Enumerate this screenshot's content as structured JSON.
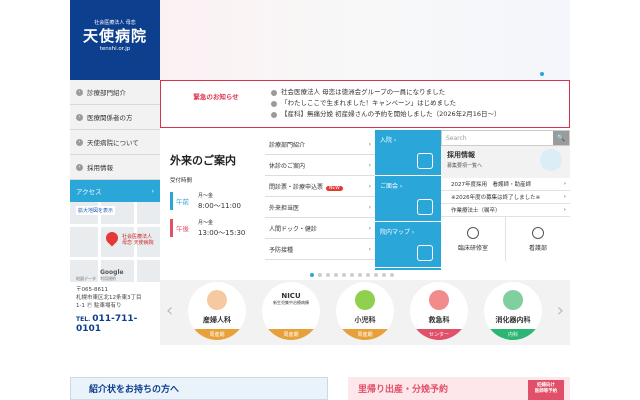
{
  "logo": {
    "org": "社会医療法人 母恋",
    "name": "天使病院",
    "url": "tenshi.or.jp"
  },
  "sidebar": {
    "items": [
      {
        "label": "診療部門紹介"
      },
      {
        "label": "医療関係者の方"
      },
      {
        "label": "天使病院について"
      },
      {
        "label": "採用情報"
      }
    ],
    "access_label": "アクセス"
  },
  "map": {
    "enlarge": "拡大地図を表示",
    "pin_label_1": "社会医療法人",
    "pin_label_2": "母恋 天使病院",
    "google": "Google",
    "map_data": "地図データ　利用規約",
    "postal": "〒065-8611",
    "address_1": "札幌市東区北12条東3丁目",
    "address_2": "1-1",
    "parking": "駐車場有り"
  },
  "tel": {
    "label": "TEL.",
    "number": "011-711-0101"
  },
  "notice": {
    "title": "緊急のお知らせ",
    "items": [
      "社会医療法人 母恋は徳洲会グループの一員になりました",
      "「わたしここで生まれました！キャンペーン」はじめました",
      "【産科】無痛分娩 初産婦さんの予約を開始しました（2026年2月16日～）"
    ]
  },
  "outpatient": {
    "title": "外来のご案内",
    "hours_label": "受付時間",
    "am_tag": "午前",
    "pm_tag": "午後",
    "am_days": "月～金",
    "am_time": "8:00～11:00",
    "pm_days": "月～金",
    "pm_time": "13:00～15:30"
  },
  "menu": {
    "items": [
      {
        "label": "診療部門紹介",
        "new": ""
      },
      {
        "label": "休診のご案内",
        "new": ""
      },
      {
        "label": "問診票・診療申込票",
        "new": "NEW"
      },
      {
        "label": "外来担当医",
        "new": ""
      },
      {
        "label": "人間ドック・健診",
        "new": ""
      },
      {
        "label": "予防接種",
        "new": ""
      }
    ]
  },
  "blue": {
    "admission": "入院",
    "visit": "ご面会",
    "floormap": "院内マップ"
  },
  "search": {
    "placeholder": "Search",
    "button": "🔍"
  },
  "recruit": {
    "title": "採用情報",
    "subtitle": "募集要項一覧へ",
    "items": [
      "2027年度採用　看護師・助産師",
      "※2026年度の募集は終了しました※",
      "作業療法士（嘱卒）"
    ],
    "btn1": "臨床研修室",
    "btn2": "看護部"
  },
  "departments": [
    {
      "name": "産婦人科",
      "tag": "周産期"
    },
    {
      "name": "NICU",
      "sub": "新生児集中治療病棟",
      "tag": "周産期"
    },
    {
      "name": "小児科",
      "tag": "周産期"
    },
    {
      "name": "救急科",
      "tag": "センター"
    },
    {
      "name": "消化器内科",
      "tag": "内科"
    }
  ],
  "banners": {
    "left": "紹介状をお持ちの方へ",
    "right": "里帰り出産・分娩予約",
    "right_badge_1": "妊婦向け",
    "right_badge_2": "医師等予約"
  },
  "colors": {
    "brand": "#0d3f8f",
    "accent": "#2ba6d9",
    "alert": "#d9334c",
    "am": "#2ba6d9",
    "pm": "#e05169"
  }
}
